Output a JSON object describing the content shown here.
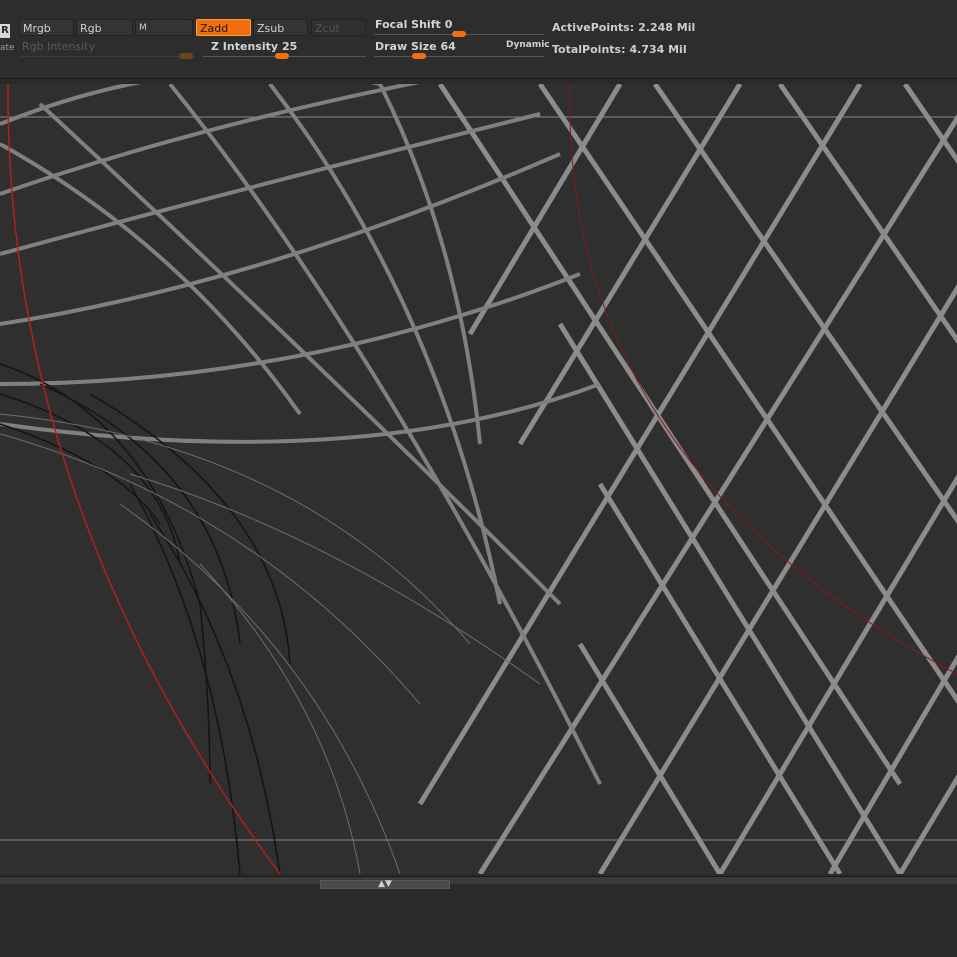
{
  "toolbar": {
    "partial_label": "ate",
    "r_badge": "R",
    "buttons": {
      "mrgb": "Mrgb",
      "rgb": "Rgb",
      "m": "M",
      "zadd": "Zadd",
      "zsub": "Zsub",
      "zcut": "Zcut"
    },
    "rgb_intensity": {
      "label": "Rgb Intensity"
    },
    "z_intensity": {
      "label": "Z Intensity",
      "value": "25"
    },
    "focal_shift": {
      "label": "Focal Shift",
      "value": "0"
    },
    "draw_size": {
      "label": "Draw Size",
      "value": "64",
      "dynamic_label": "Dynamic"
    },
    "active_points": {
      "label": "ActivePoints:",
      "value": "2.248 Mil"
    },
    "total_points": {
      "label": "TotalPoints:",
      "value": "4.734 Mil"
    }
  },
  "colors": {
    "accent": "#f07010",
    "guide_red": "#b02020",
    "mesh_light": "#9a9a9a",
    "mesh_dark": "#151515"
  },
  "icons": {
    "scroll_handle": "double-arrow-icon"
  }
}
